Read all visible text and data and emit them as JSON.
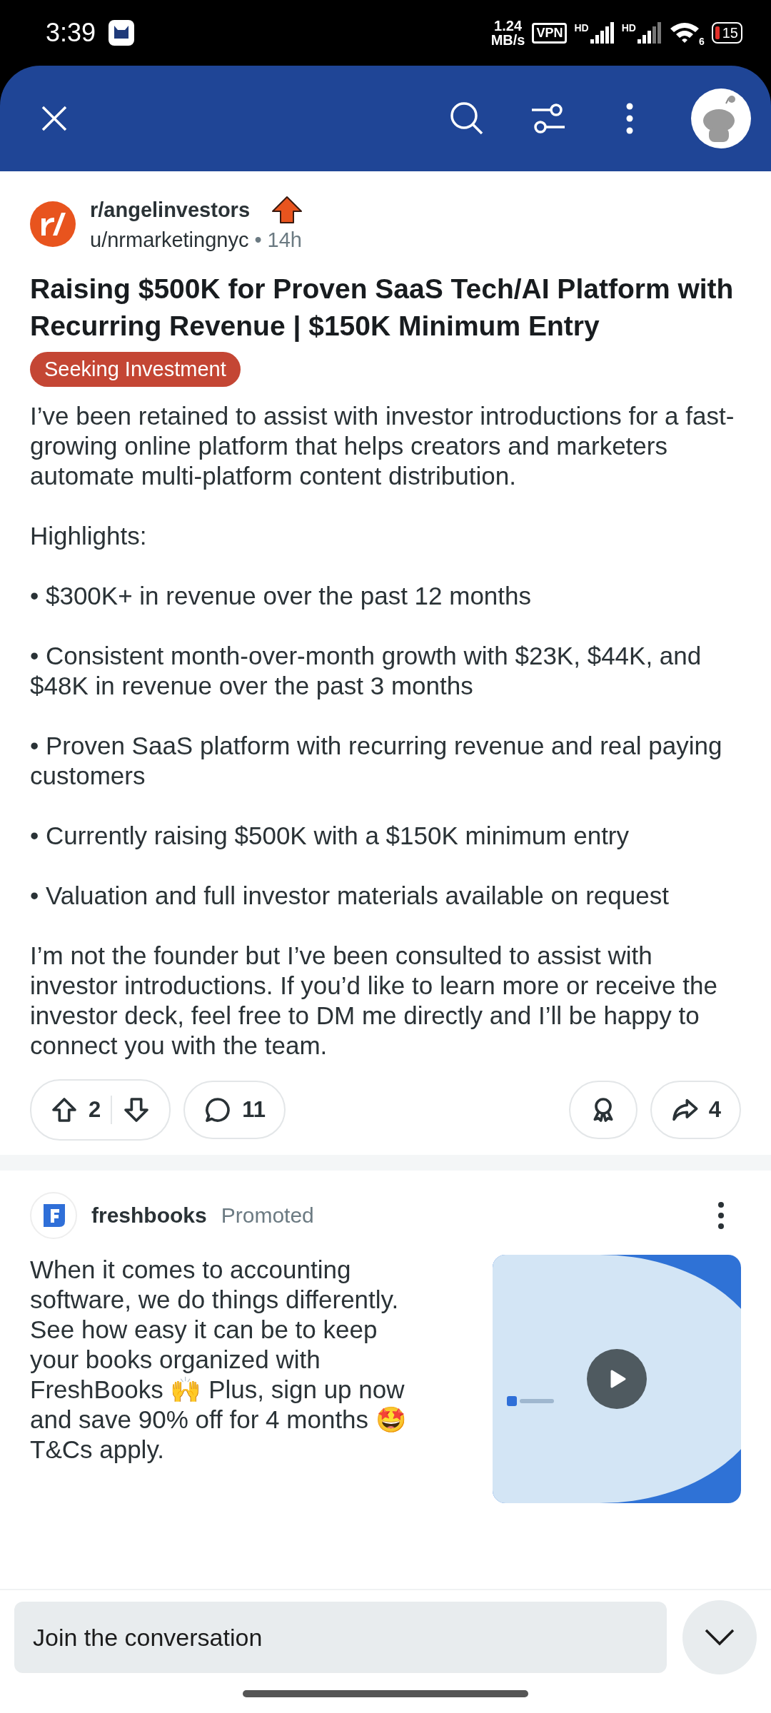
{
  "status_bar": {
    "time": "3:39",
    "net_speed": "1.24",
    "net_unit": "MB/s",
    "vpn": "VPN",
    "signal_labels": [
      "HD",
      "HD"
    ],
    "wifi_label": "6",
    "battery": "15"
  },
  "post": {
    "subreddit": "r/angelinvestors",
    "user": "u/nrmarketingnyc",
    "separator": "•",
    "age": "14h",
    "title": "Raising $500K for Proven SaaS Tech/AI Platform with Recurring Revenue | $150K Minimum Entry",
    "flair": "Seeking Investment",
    "body": [
      "I’ve been retained to assist with investor introductions for a fast-growing online platform that helps creators and marketers automate multi-platform content distribution.",
      "Highlights:",
      "• $300K+ in revenue over the past 12 months",
      "• Consistent month-over-month growth with $23K, $44K, and $48K in revenue over the past 3 months",
      "• Proven SaaS platform with recurring revenue and real paying customers",
      "• Currently raising $500K with a $150K minimum entry",
      "• Valuation and full investor materials available on request",
      "I’m not the founder but I’ve been consulted to assist with investor introductions. If you’d like to learn more or receive the investor deck, feel free to DM me directly and I’ll be happy to connect you with the team."
    ],
    "votes": "2",
    "comments": "11",
    "shares": "4"
  },
  "ad": {
    "advertiser": "freshbooks",
    "label": "Promoted",
    "text": "When it comes to accounting software, we do things differently. See how easy it can be to keep your books organized with FreshBooks 🙌 Plus, sign up now and save 90% off for 4 months 🤩 T&Cs apply."
  },
  "composer": {
    "placeholder": "Join the conversation"
  }
}
